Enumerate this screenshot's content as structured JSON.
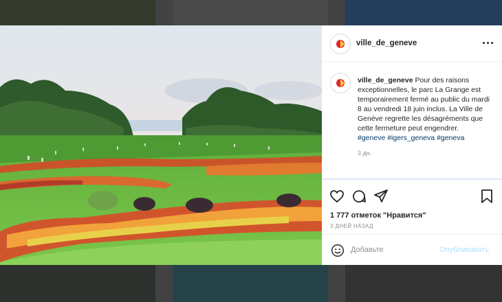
{
  "post": {
    "username": "ville_de_geneve",
    "caption_username": "ville_de_geneve",
    "caption_text": "Pour des raisons exceptionnelles, le parc La Grange est temporairement fermé au public du mardi 8 au vendredi 18 juin inclus. La Ville de Genève regrette les désagréments que cette fermeture peut engendrer.",
    "hashtags": [
      "#geneve",
      "#igers_geneva",
      "#geneva"
    ],
    "caption_time": "3 дн.",
    "likes": "1 777 отметок \"Нравится\"",
    "posted_ago": "3 ДНЕЙ НАЗАД"
  },
  "comment": {
    "placeholder": "Добавьте",
    "post_label": "Опубликовать"
  },
  "icons": {
    "more": "more-options-icon",
    "like": "heart-icon",
    "comment": "comment-icon",
    "share": "share-icon",
    "save": "bookmark-icon",
    "emoji": "emoji-icon"
  },
  "colors": {
    "brand_red": "#e0262d",
    "link": "#00376b",
    "post_disabled": "#b2dffc"
  }
}
